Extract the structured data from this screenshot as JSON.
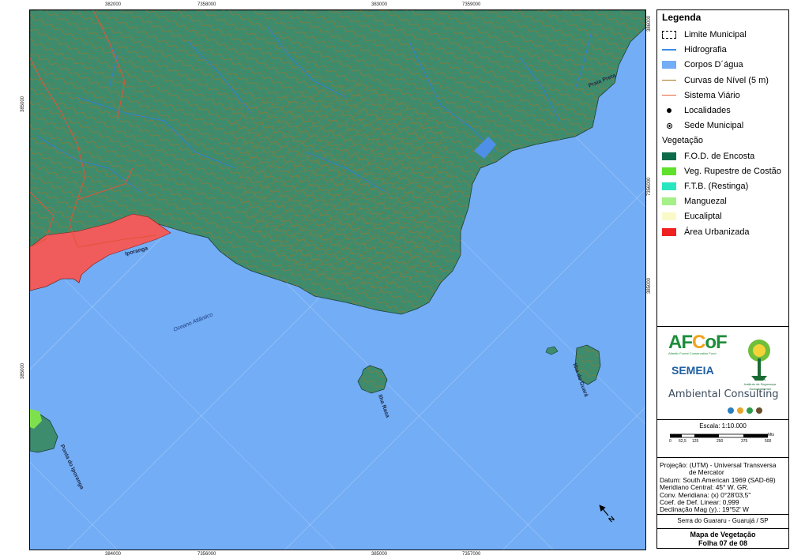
{
  "map": {
    "grid_ticks": {
      "top": [
        "382000",
        "7358000",
        "383000",
        "7359000"
      ],
      "bottom": [
        "384000",
        "7356000",
        "385000",
        "7357000"
      ],
      "right": [
        "386000",
        "7356000",
        "385000"
      ],
      "left": [
        "385000",
        "385000"
      ]
    },
    "labels": {
      "praia_preta": "Praia Preta",
      "iporanga": "Iporanga",
      "oceano": "Oceano Atlântico",
      "ilha_rasa": "Ilha Rasa",
      "ilha_guara": "Ilha do Guará",
      "ponta": "Ponta do Iporanga"
    },
    "colors": {
      "water": "#73adf5",
      "forest": "#3e8c6e",
      "urban": "#f05b5b",
      "restinga_veg": "#7ee04c",
      "contour": "#a8731e",
      "river": "#2f7fe0"
    }
  },
  "legend": {
    "title": "Legenda",
    "items": [
      {
        "label": "Limite Municipal",
        "symbol": "dash",
        "color": "#000000"
      },
      {
        "label": "Hidrografia",
        "symbol": "line",
        "color": "#3c8ae6"
      },
      {
        "label": "Corpos D´água",
        "symbol": "fill",
        "color": "#73adf5"
      },
      {
        "label": "Curvas de Nível (5 m)",
        "symbol": "line",
        "color": "#a8731e"
      },
      {
        "label": "Sistema Viário",
        "symbol": "line",
        "color": "#e8653a"
      },
      {
        "label": "Localidades",
        "symbol": "dot",
        "color": "#000000"
      },
      {
        "label": "Sede Municipal",
        "symbol": "sede",
        "color": "#000000"
      }
    ],
    "veg_title": "Vegetação",
    "veg_items": [
      {
        "label": "F.O.D. de Encosta",
        "color": "#0d6b4a"
      },
      {
        "label": "Veg. Rupestre de Costão",
        "color": "#5fe02a"
      },
      {
        "label": "F.T.B. (Restinga)",
        "color": "#28e6c0"
      },
      {
        "label": "Manguezal",
        "color": "#a6f08a"
      },
      {
        "label": "Eucaliptal",
        "color": "#fafac8"
      },
      {
        "label": "Área Urbanizada",
        "color": "#ee2222"
      }
    ]
  },
  "logos": {
    "afcof": "AFCoF",
    "afcof_sub": "Atlantic Forest Conservation Fund",
    "semeia": "SEMEIA",
    "issa": "ISSA",
    "issa_sub": "Instituto de Segurança Socioambiental",
    "ambiental": "Ambiental Consulting"
  },
  "scale": {
    "title": "Escala: 1:10.000",
    "ticks": [
      "0",
      "62,5",
      "125",
      "250",
      "375",
      "500"
    ],
    "unit": "Mts"
  },
  "projection": {
    "lines": [
      "Projeção: (UTM) - Universal Transversa",
      "de Mercator",
      "Datum: South American 1969 (SAD-69)",
      "Meridiano Central: 45° W. GR.",
      "Conv. Meridiana: (x) 0°28'03,5\"",
      "Coef. de Def. Linear: 0,999",
      "Declinação Mag (y).: 19°52' W"
    ]
  },
  "location": "Serra do Guararu - Guarujá / SP",
  "sheet": {
    "title": "Mapa de Vegetação",
    "page": "Folha 07 de 08"
  }
}
